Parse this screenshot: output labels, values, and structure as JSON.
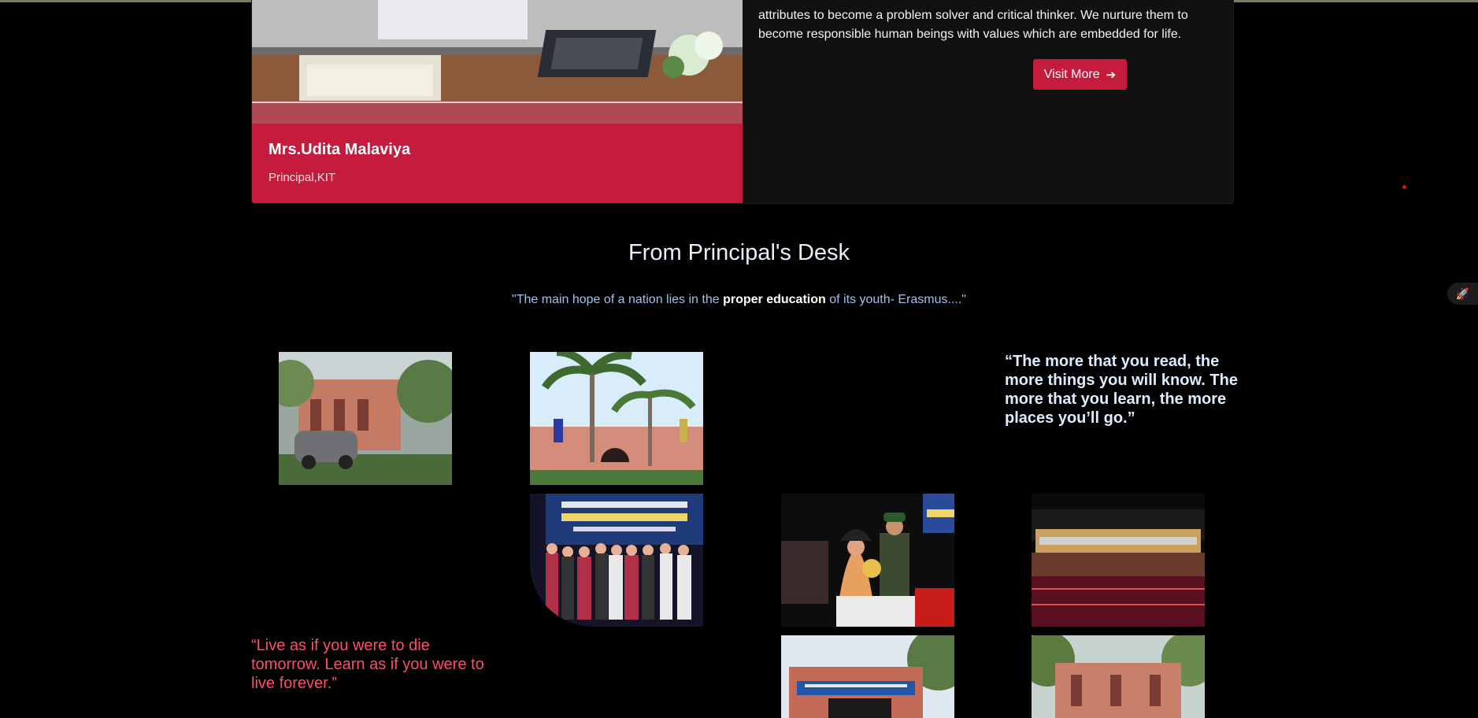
{
  "principal_card": {
    "name": "Mrs.Udita Malaviya",
    "role": "Principal,KIT",
    "text": "attributes to become a problem solver and critical thinker. We nurture them to become responsible human beings with values which are embedded for life.",
    "button_label": "Visit More",
    "button_icon": "arrow-right-circle-icon"
  },
  "desk": {
    "title": "From Principal's Desk",
    "quote_prefix": "\"The main hope of a nation lies in the ",
    "quote_bold": "proper education",
    "quote_suffix": " of its youth- Erasmus....\""
  },
  "quotes": {
    "right": "“The more that you read, the more things you will know. The more that you learn, the more places you’ll go.”",
    "left": "“Live as if you were to die tomorrow. Learn as if you were to live forever.”"
  },
  "gallery": [
    "campus-building-with-car",
    "campus-palm-trees",
    "students-group-on-stage",
    "guest-felicitation",
    "annual-function-group",
    "institute-gate",
    "campus-building-front"
  ],
  "colors": {
    "accent": "#c51b3c",
    "card_bg": "#111111",
    "title": "#e6f0fb",
    "quote_blue": "#9fc1ec",
    "quote_red": "#ff4d6a"
  },
  "widgets": {
    "side_icon": "rocket-icon"
  }
}
